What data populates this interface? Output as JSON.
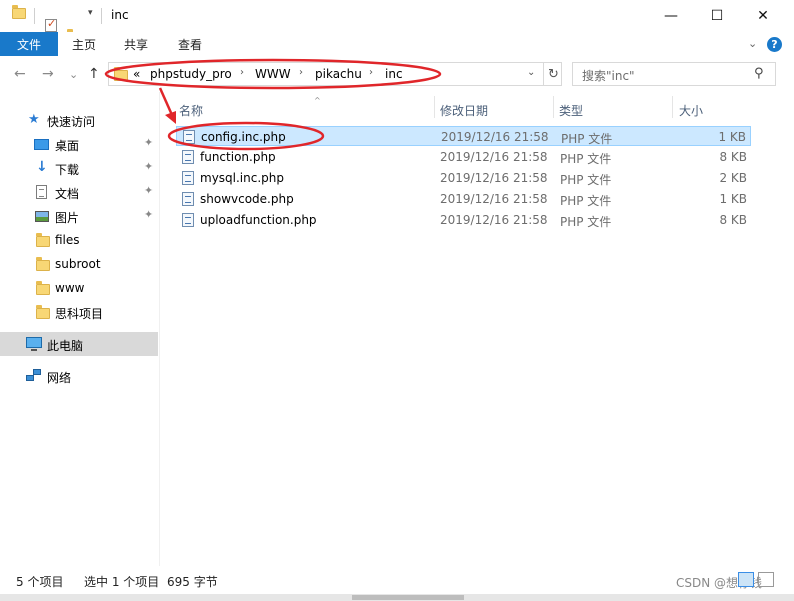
{
  "window": {
    "title": "inc",
    "minimize_glyph": "—",
    "maximize_glyph": "☐",
    "close_glyph": "✕"
  },
  "quick_access_toolbar": {
    "dropdown_glyph": "▾"
  },
  "ribbon": {
    "tabs": [
      "文件",
      "主页",
      "共享",
      "查看"
    ],
    "expand_glyph": "⌄",
    "help_glyph": "?"
  },
  "navigation": {
    "back_glyph": "←",
    "forward_glyph": "→",
    "recent_glyph": "⌄",
    "up_glyph": "↑"
  },
  "address_bar": {
    "overflow": "«",
    "separator": "›",
    "breadcrumbs": [
      "phpstudy_pro",
      "WWW",
      "pikachu",
      "inc"
    ],
    "dropdown_glyph": "⌄",
    "refresh_glyph": "↻"
  },
  "search": {
    "placeholder": "搜索\"inc\"",
    "icon_glyph": "⚲"
  },
  "nav_pane": {
    "quick_access": "快速访问",
    "pinned": [
      "桌面",
      "下载",
      "文档",
      "图片"
    ],
    "pin_glyph": "✦",
    "folders": [
      "files",
      "subroot",
      "www",
      "思科项目"
    ],
    "this_pc": "此电脑",
    "network": "网络"
  },
  "file_list": {
    "columns": {
      "name": "名称",
      "date": "修改日期",
      "type": "类型",
      "size": "大小"
    },
    "sort_glyph": "^",
    "rows": [
      {
        "name": "config.inc.php",
        "date": "2019/12/16 21:58",
        "type": "PHP 文件",
        "size": "1 KB",
        "selected": true
      },
      {
        "name": "function.php",
        "date": "2019/12/16 21:58",
        "type": "PHP 文件",
        "size": "8 KB",
        "selected": false
      },
      {
        "name": "mysql.inc.php",
        "date": "2019/12/16 21:58",
        "type": "PHP 文件",
        "size": "2 KB",
        "selected": false
      },
      {
        "name": "showvcode.php",
        "date": "2019/12/16 21:58",
        "type": "PHP 文件",
        "size": "1 KB",
        "selected": false
      },
      {
        "name": "uploadfunction.php",
        "date": "2019/12/16 21:58",
        "type": "PHP 文件",
        "size": "8 KB",
        "selected": false
      }
    ]
  },
  "status_bar": {
    "item_count": "5 个项目",
    "selection": "选中 1 个项目",
    "size": "695 字节",
    "watermark": "CSDN @想存钱"
  },
  "colors": {
    "accent": "#1979ca",
    "selection_bg": "#cce8ff",
    "selection_border": "#99d1ff",
    "annotation_red": "#e0262a",
    "folder": "#f8d775"
  }
}
